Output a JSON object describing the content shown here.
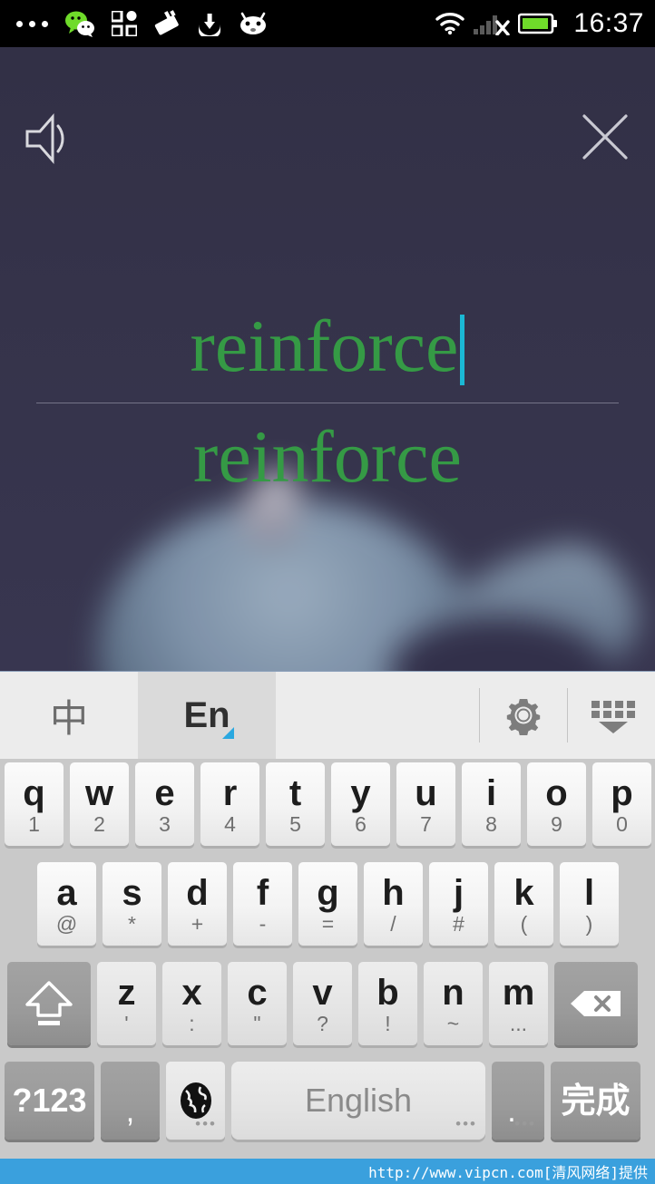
{
  "status_bar": {
    "time": "16:37",
    "left_icons": [
      "more-dots-icon",
      "wechat-icon",
      "qr-grid-icon",
      "card-icon",
      "download-icon",
      "robot-face-icon"
    ],
    "right_icons": [
      "wifi-icon",
      "signal-no-sim-icon",
      "battery-icon"
    ],
    "battery_color": "#6fdb2a",
    "wechat_color": "#6fdb2a",
    "background": "#000000"
  },
  "app": {
    "background_color": "#35334a",
    "speaker_icon": "speaker-volume-icon",
    "close_icon": "close-x-icon",
    "input_text": "reinforce",
    "suggestion_text": "reinforce",
    "text_color": "#359a45",
    "caret_color": "#1bb8d4"
  },
  "keyboard": {
    "toolbar": {
      "chinese_tab": "中",
      "english_tab": "En",
      "settings_icon": "gear-icon",
      "hide_keyboard_icon": "keyboard-hide-icon",
      "active_tab": "En",
      "accent_color": "#2aa8e0"
    },
    "row1": [
      {
        "main": "q",
        "sub": "1"
      },
      {
        "main": "w",
        "sub": "2"
      },
      {
        "main": "e",
        "sub": "3"
      },
      {
        "main": "r",
        "sub": "4"
      },
      {
        "main": "t",
        "sub": "5"
      },
      {
        "main": "y",
        "sub": "6"
      },
      {
        "main": "u",
        "sub": "7"
      },
      {
        "main": "i",
        "sub": "8"
      },
      {
        "main": "o",
        "sub": "9"
      },
      {
        "main": "p",
        "sub": "0"
      }
    ],
    "row2": [
      {
        "main": "a",
        "sub": "@"
      },
      {
        "main": "s",
        "sub": "*"
      },
      {
        "main": "d",
        "sub": "+"
      },
      {
        "main": "f",
        "sub": "-"
      },
      {
        "main": "g",
        "sub": "="
      },
      {
        "main": "h",
        "sub": "/"
      },
      {
        "main": "j",
        "sub": "#"
      },
      {
        "main": "k",
        "sub": "("
      },
      {
        "main": "l",
        "sub": ")"
      }
    ],
    "row3": {
      "shift_icon": "shift-arrow-icon",
      "keys": [
        {
          "main": "z",
          "sub": "'"
        },
        {
          "main": "x",
          "sub": ":"
        },
        {
          "main": "c",
          "sub": "\""
        },
        {
          "main": "v",
          "sub": "?"
        },
        {
          "main": "b",
          "sub": "!"
        },
        {
          "main": "n",
          "sub": "~"
        },
        {
          "main": "m",
          "sub": "..."
        }
      ],
      "backspace_icon": "backspace-icon"
    },
    "row4": {
      "symbols_label": "?123",
      "comma_label": ",",
      "globe_icon": "globe-language-icon",
      "space_label": "English",
      "period_label": ".",
      "done_label": "完成"
    }
  },
  "watermark": {
    "text": "http://www.vipcn.com[清风网络]提供",
    "background": "#3aa0dd"
  }
}
